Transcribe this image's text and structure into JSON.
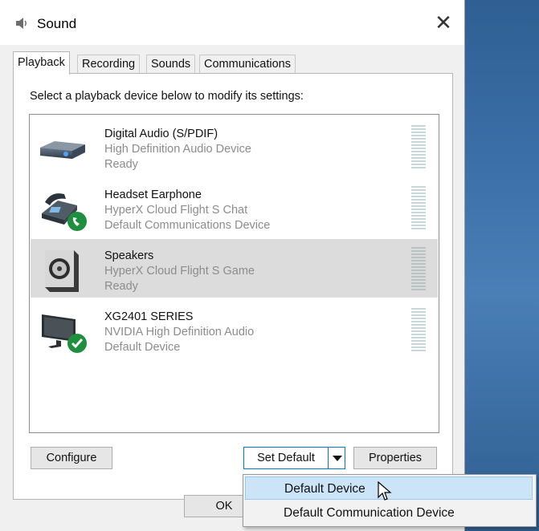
{
  "window": {
    "title": "Sound",
    "close_glyph": "✕"
  },
  "tabs": [
    {
      "label": "Playback",
      "active": true
    },
    {
      "label": "Recording",
      "active": false
    },
    {
      "label": "Sounds",
      "active": false
    },
    {
      "label": "Communications",
      "active": false
    }
  ],
  "instruction": "Select a playback device below to modify its settings:",
  "devices": [
    {
      "name": "Digital Audio (S/PDIF)",
      "driver": "High Definition Audio Device",
      "status": "Ready",
      "icon": "digital-audio-icon",
      "selected": false
    },
    {
      "name": "Headset Earphone",
      "driver": "HyperX Cloud Flight S Chat",
      "status": "Default Communications Device",
      "icon": "headset-phone-icon",
      "selected": false
    },
    {
      "name": "Speakers",
      "driver": "HyperX Cloud Flight S Game",
      "status": "Ready",
      "icon": "speaker-icon",
      "selected": true
    },
    {
      "name": "XG2401 SERIES",
      "driver": "NVIDIA High Definition Audio",
      "status": "Default Device",
      "icon": "monitor-icon",
      "selected": false
    }
  ],
  "buttons": {
    "configure": "Configure",
    "set_default": "Set Default",
    "properties": "Properties",
    "ok": "OK"
  },
  "dropdown": {
    "items": [
      {
        "label": "Default Device",
        "hovered": true
      },
      {
        "label": "Default Communication Device",
        "hovered": false
      }
    ]
  },
  "colors": {
    "accent": "#0078d7",
    "selected_row": "#dcdcdc",
    "hover_item": "#cce4f7",
    "default_badge": "#1e8f3e"
  }
}
